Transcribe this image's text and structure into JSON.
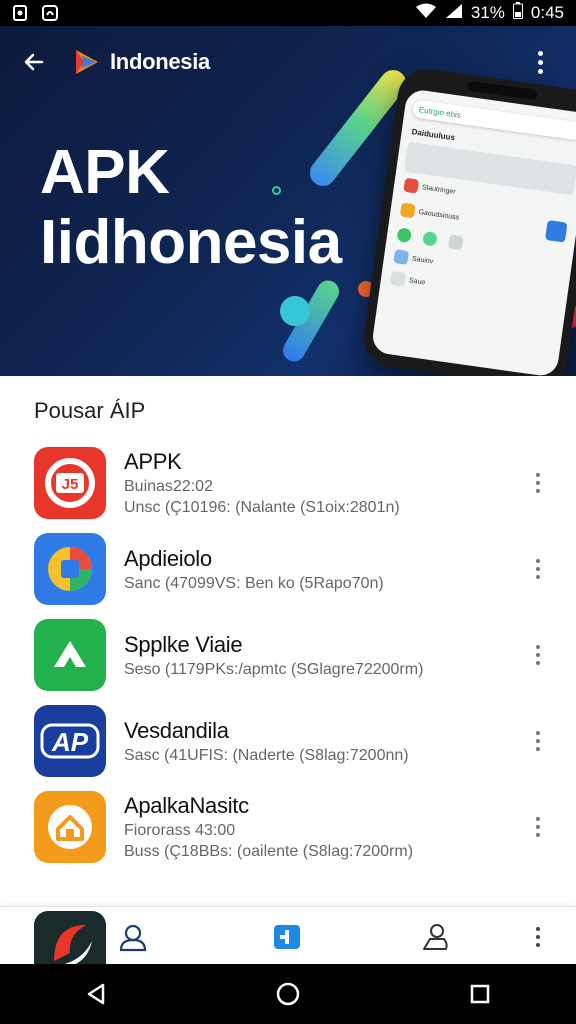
{
  "status_bar": {
    "battery_percent": "31%",
    "time": "0:45"
  },
  "header": {
    "brand_name": "Indonesia",
    "hero_line1": "APK",
    "hero_line2": "Iidhonesia"
  },
  "phone_mockup": {
    "search_text": "Eutrgio ebis",
    "heading": "Daiduuluus",
    "rows": [
      "Slautringer",
      "Gaoudsiouss",
      "Sauiov",
      "Saue"
    ]
  },
  "section": {
    "title": "Pousar ÁIP"
  },
  "apps": [
    {
      "name": "APPK",
      "sub": "Buinas22:02",
      "meta": "Unsc (Ç10196: (Nalante (S1oix:2801n)",
      "icon": "orange-round-icon",
      "badge": "J5"
    },
    {
      "name": "Apdieiolo",
      "sub": "",
      "meta": "Sanc (47099VS: Ben ko (5Rapo70n)",
      "icon": "colorful-square-icon",
      "badge": ""
    },
    {
      "name": "Spplke Viaie",
      "sub": "",
      "meta": "Seso (1179PKs:/apmtc (SGlagre72200rm)",
      "icon": "green-arrow-icon",
      "badge": ""
    },
    {
      "name": "Vesdandila",
      "sub": "",
      "meta": "Sasc (41UFIS: (Naderte (S8lag:7200nn)",
      "icon": "ap-logo-icon",
      "badge": "AP"
    },
    {
      "name": "ApalkaNasitc",
      "sub": "Fiororass 43:00",
      "meta": "Buss (Ç18BBs: (oailente (S8lag:7200rm)",
      "icon": "orange-house-icon",
      "badge": ""
    }
  ],
  "colors": {
    "banner_bg": "#0f2552",
    "accent_blue": "#1e88e5",
    "status_bg": "#000000"
  }
}
